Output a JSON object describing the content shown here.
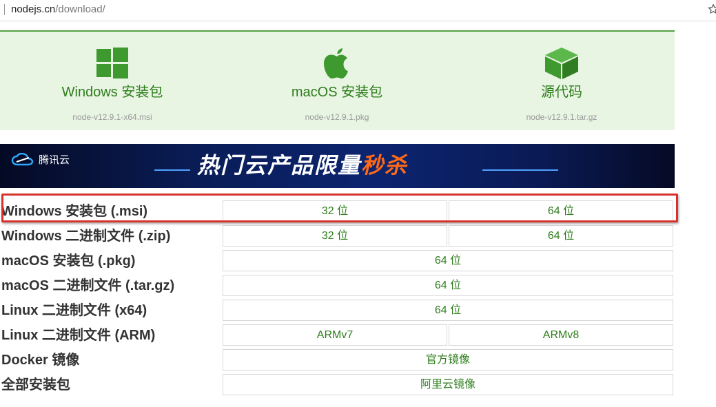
{
  "browser": {
    "url_host": "nodejs.cn",
    "url_path": "/download/"
  },
  "downloads": [
    {
      "label": "Windows 安装包",
      "file": "node-v12.9.1-x64.msi",
      "icon": "windows-icon"
    },
    {
      "label": "macOS 安装包",
      "file": "node-v12.9.1.pkg",
      "icon": "apple-icon"
    },
    {
      "label": "源代码",
      "file": "node-v12.9.1.tar.gz",
      "icon": "box-icon"
    }
  ],
  "banner": {
    "logo_text": "腾讯云",
    "slogan_main": "热门云产品限量",
    "slogan_highlight": "秒杀"
  },
  "table": {
    "rows": [
      {
        "label": "Windows 安装包 (.msi)",
        "cells": [
          "32 位",
          "64 位"
        ]
      },
      {
        "label": "Windows 二进制文件 (.zip)",
        "cells": [
          "32 位",
          "64 位"
        ]
      },
      {
        "label": "macOS 安装包 (.pkg)",
        "cells": [
          "64 位"
        ]
      },
      {
        "label": "macOS 二进制文件 (.tar.gz)",
        "cells": [
          "64 位"
        ]
      },
      {
        "label": "Linux 二进制文件 (x64)",
        "cells": [
          "64 位"
        ]
      },
      {
        "label": "Linux 二进制文件 (ARM)",
        "cells": [
          "ARMv7",
          "ARMv8"
        ]
      },
      {
        "label": "Docker 镜像",
        "cells": [
          "官方镜像"
        ]
      },
      {
        "label": "全部安装包",
        "cells": [
          "阿里云镜像"
        ]
      }
    ]
  },
  "colors": {
    "accent_green": "#2e7d1c",
    "panel_bg": "#e8f5e3",
    "highlight_red": "#d8322c"
  }
}
